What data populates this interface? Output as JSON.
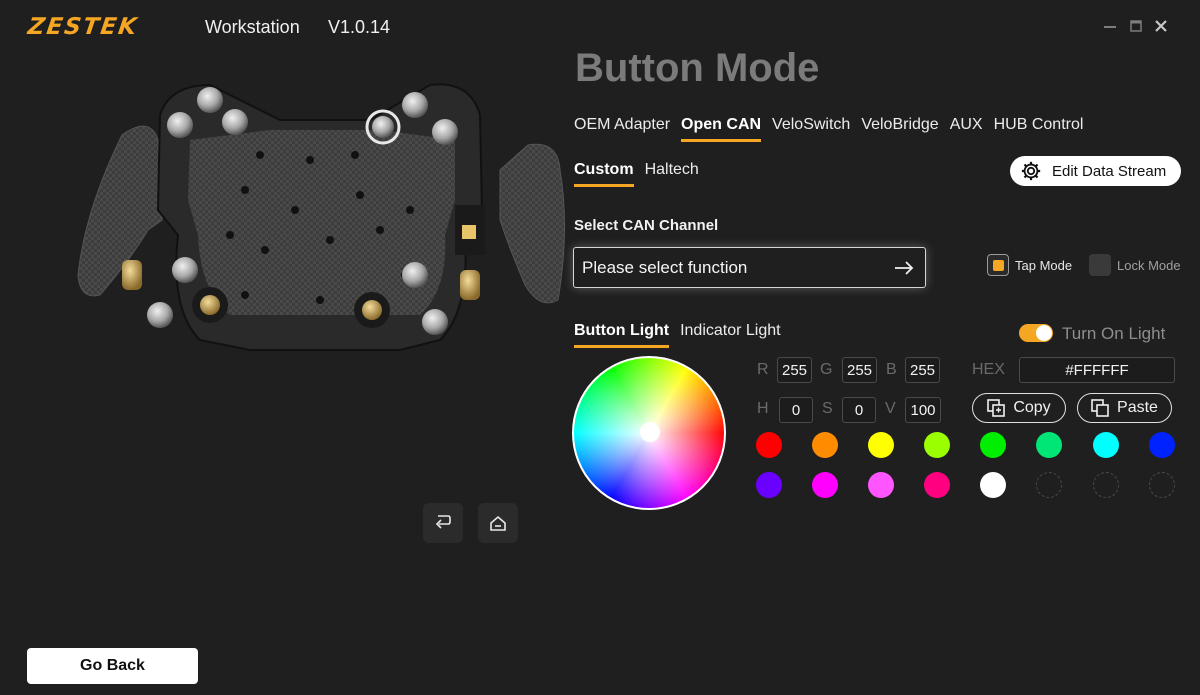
{
  "header": {
    "logo": "ZESTEK",
    "title": "Workstation",
    "version": "V1.0.14"
  },
  "page_title": "Button Mode",
  "device_tabs": [
    {
      "label": "OEM Adapter",
      "active": false
    },
    {
      "label": "Open CAN",
      "active": true
    },
    {
      "label": "VeloSwitch",
      "active": false
    },
    {
      "label": "VeloBridge",
      "active": false
    },
    {
      "label": "AUX",
      "active": false
    },
    {
      "label": "HUB Control",
      "active": false
    }
  ],
  "sub_tabs": [
    {
      "label": "Custom",
      "active": true
    },
    {
      "label": "Haltech",
      "active": false
    }
  ],
  "edit_stream": {
    "label": "Edit Data Stream"
  },
  "can_channel": {
    "label": "Select CAN Channel",
    "placeholder": "Please select function"
  },
  "modes": {
    "tap": {
      "label": "Tap Mode",
      "checked": true
    },
    "lock": {
      "label": "Lock Mode",
      "checked": false
    }
  },
  "light_tabs": [
    {
      "label": "Button Light",
      "active": true
    },
    {
      "label": "Indicator Light",
      "active": false
    }
  ],
  "turn_on_light": {
    "label": "Turn On Light",
    "on": true
  },
  "color": {
    "r_label": "R",
    "g_label": "G",
    "b_label": "B",
    "r": "255",
    "g": "255",
    "b": "255",
    "h_label": "H",
    "s_label": "S",
    "v_label": "V",
    "h": "0",
    "s": "0",
    "v": "100",
    "hex_label": "HEX",
    "hex": "#FFFFFF"
  },
  "copy": {
    "label": "Copy"
  },
  "paste": {
    "label": "Paste"
  },
  "swatches_row1": [
    "#ff0000",
    "#ff8c00",
    "#ffff00",
    "#9aff00",
    "#00ee00",
    "#00e676",
    "#00ffff",
    "#0022ff"
  ],
  "swatches_row2": [
    "#6a00ff",
    "#ff00ff",
    "#ff55ff",
    "#ff0080",
    "#ffffff",
    "",
    "",
    ""
  ],
  "go_back": {
    "label": "Go Back"
  },
  "colors": {
    "accent": "#f5a623",
    "background": "#1f1f1f"
  },
  "icons": [
    "undo-icon",
    "home-icon",
    "settings-gear-icon",
    "arrow-right-icon",
    "copy-icon",
    "paste-icon",
    "minimize-icon",
    "maximize-icon",
    "close-icon"
  ]
}
